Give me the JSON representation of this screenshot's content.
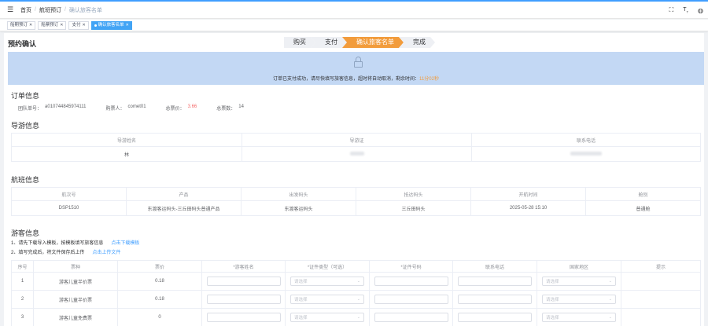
{
  "header": {
    "breadcrumbs": [
      "首页",
      "航班预订",
      "确认旅客名单"
    ],
    "right_icons": [
      "fullscreen-icon",
      "font-size-icon",
      "user-avatar-icon"
    ]
  },
  "tags": [
    {
      "label": "船期预订",
      "active": false
    },
    {
      "label": "船票预订",
      "active": false
    },
    {
      "label": "支付",
      "active": false
    },
    {
      "label": "确认旅客名单",
      "active": true
    }
  ],
  "page": {
    "title": "预约确认"
  },
  "steps": [
    {
      "label": "购买",
      "active": false
    },
    {
      "label": "支付",
      "active": false
    },
    {
      "label": "确认旅客名单",
      "active": true
    },
    {
      "label": "完成",
      "active": false
    }
  ],
  "notice": {
    "text": "订单已支付成功，请尽快填写旅客信息，超时将自动取消，剩余时间：",
    "countdown": "11分02秒"
  },
  "order": {
    "heading": "订单信息",
    "order_no_label": "团队单号：",
    "order_no": "a010744845974111",
    "buyer_label": "购票人：",
    "buyer": "comet01",
    "total_price_label": "总票价：",
    "total_price": "3.66",
    "total_tickets_label": "总票数：",
    "total_tickets": "14"
  },
  "guide": {
    "heading": "导游信息",
    "columns": [
      "导游姓名",
      "导游证",
      "联系电话"
    ],
    "row": [
      "林",
      "",
      ""
    ]
  },
  "flight": {
    "heading": "航班信息",
    "columns": [
      "航次号",
      "产品",
      "出发码头",
      "抵达码头",
      "开航时间",
      "舱别"
    ],
    "row": [
      "DSP1510",
      "东渡客运码头-三丘田码头普通产品",
      "东渡客运码头",
      "三丘田码头",
      "2025-05-28 15:10",
      "普通舱"
    ]
  },
  "passengers": {
    "heading": "游客信息",
    "instruction1": "1、请先下载导入模板，按模板填写旅客信息",
    "instruction1_link": "点击下载模板",
    "instruction2": "2、填写完成后，将文件保存后上传",
    "instruction2_link": "点击上传文件",
    "columns": [
      "序号",
      "票种",
      "票价",
      "*游客姓名",
      "*证件类型（可选）",
      "*证件号码",
      "联系电话",
      "国家地区",
      "提示"
    ],
    "select_placeholder": "请选择",
    "rows": [
      {
        "index": "1",
        "ticket_type": "游客儿童半价票",
        "price": "0.18"
      },
      {
        "index": "2",
        "ticket_type": "游客儿童半价票",
        "price": "0.18"
      },
      {
        "index": "3",
        "ticket_type": "游客儿童免费票",
        "price": "0"
      }
    ]
  }
}
